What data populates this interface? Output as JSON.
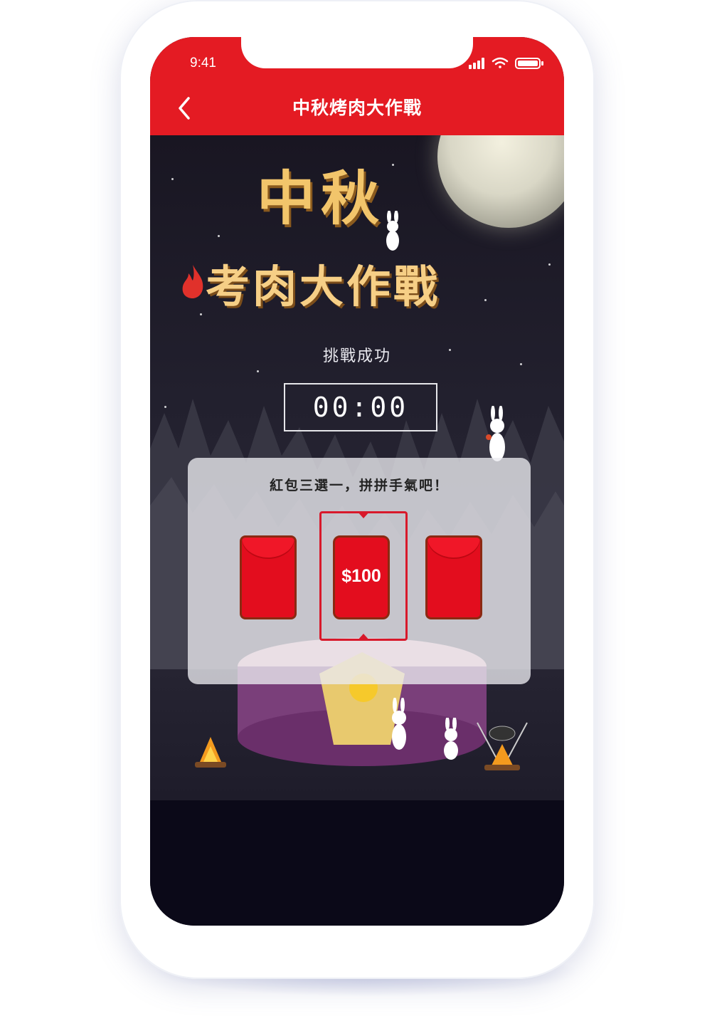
{
  "status_bar": {
    "time": "9:41"
  },
  "header": {
    "title": "中秋烤肉大作戰"
  },
  "game": {
    "title_line1": "中秋",
    "title_line2": "考肉大作戰",
    "status": "挑戰成功",
    "timer": "00:00"
  },
  "panel": {
    "title": "紅包三選一，拼拼手氣吧！",
    "envelopes": [
      {
        "amount": ""
      },
      {
        "amount": "$100"
      },
      {
        "amount": ""
      }
    ]
  },
  "colors": {
    "header": "#e41b23",
    "envelope": "#e30d1e",
    "title_gold": "#f2c56b"
  }
}
